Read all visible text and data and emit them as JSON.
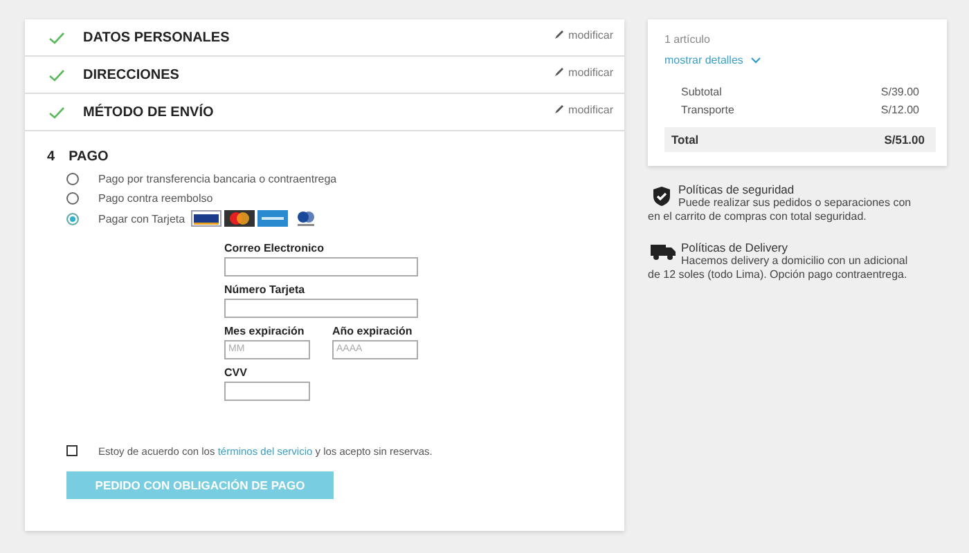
{
  "steps": [
    {
      "title": "DATOS PERSONALES",
      "completed": true,
      "action": "modificar"
    },
    {
      "title": "DIRECCIONES",
      "completed": true,
      "action": "modificar"
    },
    {
      "title": "MÉTODO DE ENVÍO",
      "completed": true,
      "action": "modificar"
    }
  ],
  "payment": {
    "number": "4",
    "title": "PAGO",
    "options": [
      {
        "label": "Pago por transferencia bancaria o contraentrega",
        "selected": false,
        "cards": false
      },
      {
        "label": "Pago contra reembolso",
        "selected": false,
        "cards": false
      },
      {
        "label": "Pagar con Tarjeta",
        "selected": true,
        "cards": true
      }
    ],
    "field_rows": [
      [
        {
          "label": "Correo Electronico"
        }
      ],
      [
        {
          "label": "Número Tarjeta"
        }
      ],
      [
        {
          "label": "Mes expiración",
          "placeholder": "MM"
        },
        {
          "label": "Año expiración",
          "placeholder": "AAAA"
        }
      ],
      [
        {
          "label": "CVV"
        }
      ]
    ]
  },
  "terms": {
    "checked": false,
    "text": "Estoy de acuerdo con los ",
    "link": "términos del servicio",
    "text_after": " y los acepto sin reservas."
  },
  "submit_button": "PEDIDO CON OBLIGACIÓN DE PAGO",
  "summary": {
    "items_count": "1 artículo",
    "details_link": "mostrar detalles",
    "lines": [
      {
        "label": "Subtotal",
        "value": "S/39.00"
      },
      {
        "label": "Transporte",
        "value": "S/12.00"
      }
    ],
    "total": {
      "label": "Total",
      "value": "S/51.00"
    }
  },
  "policies": [
    {
      "kind": "security",
      "title": "Políticas de seguridad",
      "text": "Puede realizar sus pedidos o separaciones con en el carrito de compras con total seguridad."
    },
    {
      "kind": "delivery",
      "title": "Políticas de Delivery",
      "text": "Hacemos delivery a domicilio con un adicional de 12 soles (todo Lima). Opción pago contraentrega."
    }
  ]
}
